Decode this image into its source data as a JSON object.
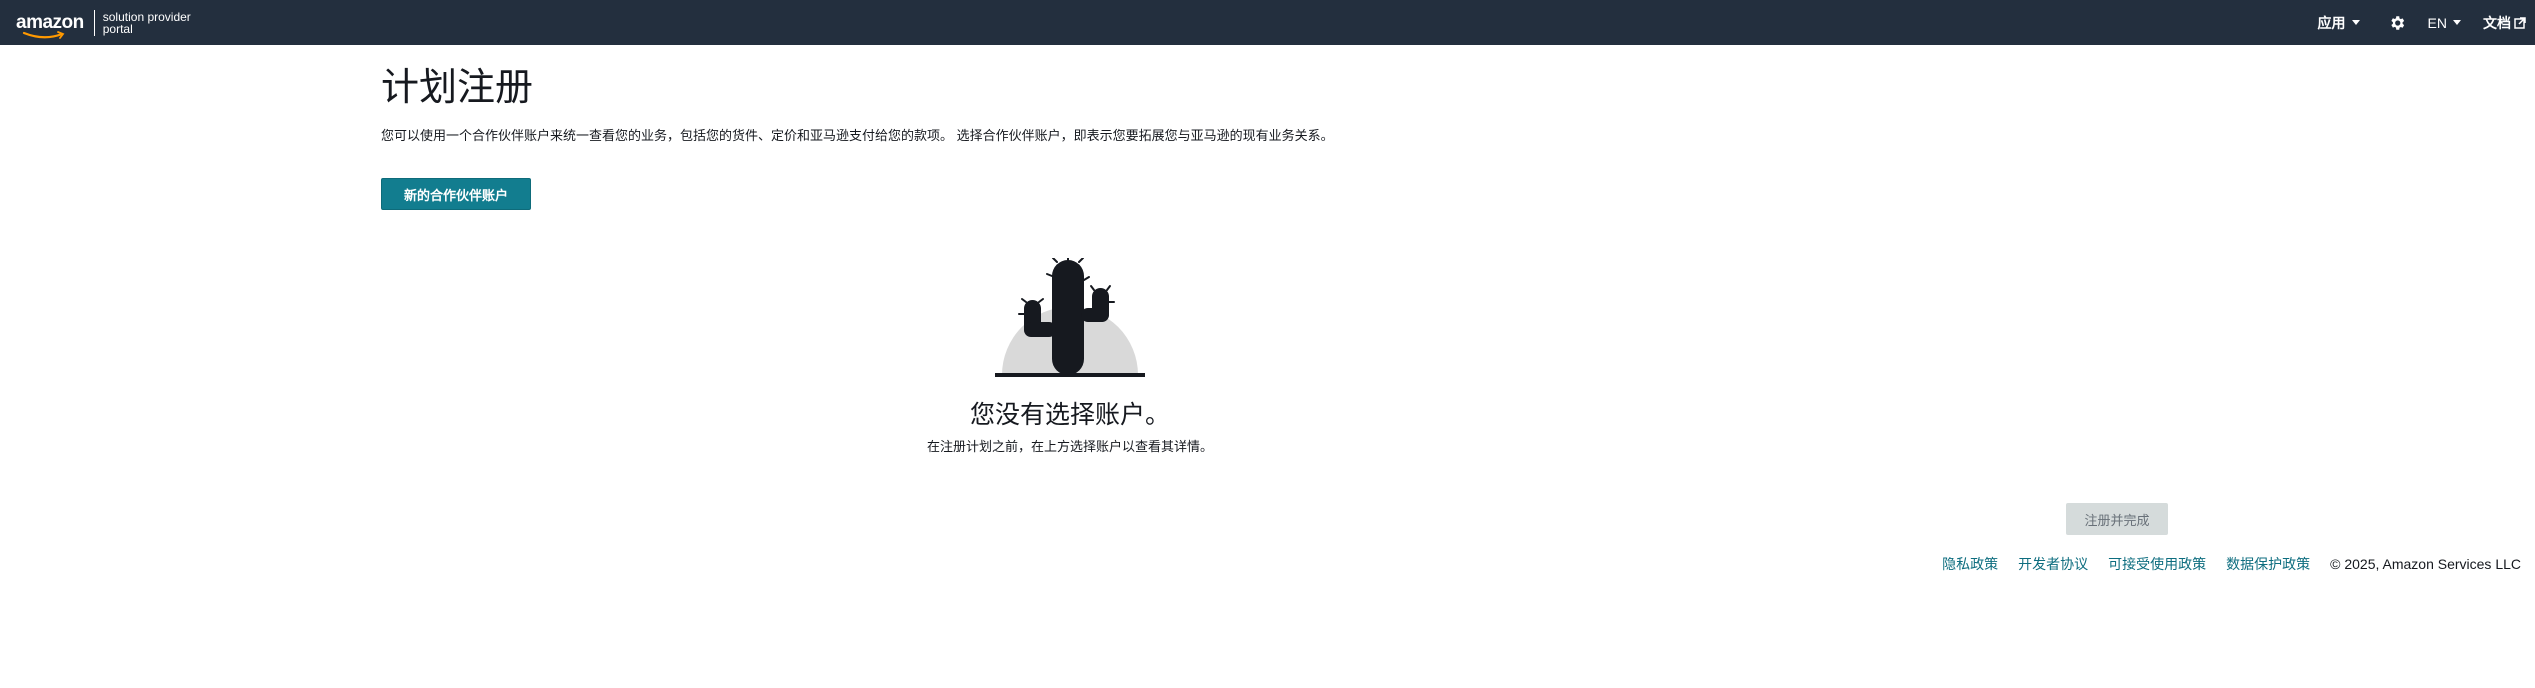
{
  "header": {
    "logo_word": "amazon",
    "logo_sub_line1": "solution provider",
    "logo_sub_line2": "portal",
    "nav": {
      "apps_label": "应用",
      "language_label": "EN",
      "docs_label": "文档"
    },
    "bg_color": "#232f3e"
  },
  "page": {
    "title": "计划注册",
    "description": "您可以使用一个合作伙伴账户来统一查看您的业务，包括您的货件、定价和亚马逊支付给您的款项。 选择合作伙伴账户，即表示您要拓展您与亚马逊的现有业务关系。",
    "new_account_button": "新的合作伙伴账户"
  },
  "empty_state": {
    "illustration": "cactus-illustration",
    "title": "您没有选择账户。",
    "description": "在注册计划之前，在上方选择账户以查看其详情。"
  },
  "actions": {
    "register_complete_button": "注册并完成"
  },
  "footer": {
    "privacy": "隐私政策",
    "developer_agreement": "开发者协议",
    "acceptable_use": "可接受使用政策",
    "data_protection": "数据保护政策",
    "copyright": "© 2025, Amazon Services LLC"
  },
  "colors": {
    "primary": "#127d8f",
    "link": "#0d6d7f",
    "disabled_bg": "#d5dbdb"
  }
}
